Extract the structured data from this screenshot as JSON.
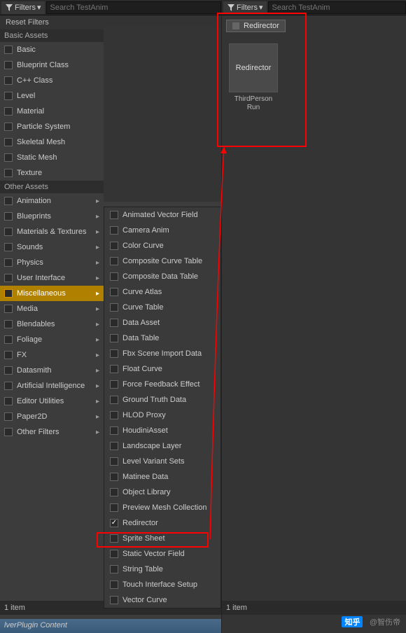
{
  "left": {
    "filters_label": "Filters",
    "search_placeholder": "Search TestAnim",
    "reset_label": "Reset Filters",
    "basic_header": "Basic Assets",
    "basic": [
      "Basic",
      "Blueprint Class",
      "C++ Class",
      "Level",
      "Material",
      "Particle System",
      "Skeletal Mesh",
      "Static Mesh",
      "Texture"
    ],
    "other_header": "Other Assets",
    "other": [
      "Animation",
      "Blueprints",
      "Materials & Textures",
      "Sounds",
      "Physics",
      "User Interface",
      "Miscellaneous",
      "Media",
      "Blendables",
      "Foliage",
      "FX",
      "Datasmith",
      "Artificial Intelligence",
      "Editor Utilities",
      "Paper2D",
      "Other Filters"
    ],
    "highlighted": "Miscellaneous",
    "status": "1 item",
    "footer": "lverPlugin Content"
  },
  "submenu": {
    "items": [
      "Animated Vector Field",
      "Camera Anim",
      "Color Curve",
      "Composite Curve Table",
      "Composite Data Table",
      "Curve Atlas",
      "Curve Table",
      "Data Asset",
      "Data Table",
      "Fbx Scene Import Data",
      "Float Curve",
      "Force Feedback Effect",
      "Ground Truth Data",
      "HLOD Proxy",
      "HoudiniAsset",
      "Landscape Layer",
      "Level Variant Sets",
      "Matinee Data",
      "Object Library",
      "Preview Mesh Collection",
      "Redirector",
      "Sprite Sheet",
      "Static Vector Field",
      "String Table",
      "Touch Interface Setup",
      "Vector Curve"
    ],
    "checked": "Redirector"
  },
  "right": {
    "filters_label": "Filters",
    "search_placeholder": "Search TestAnim",
    "tag": "Redirector",
    "asset_thumb_label": "Redirector",
    "asset_name": "ThirdPerson Run",
    "status": "1 item"
  },
  "watermark": {
    "logo": "知乎",
    "user": "@智伤帝"
  }
}
